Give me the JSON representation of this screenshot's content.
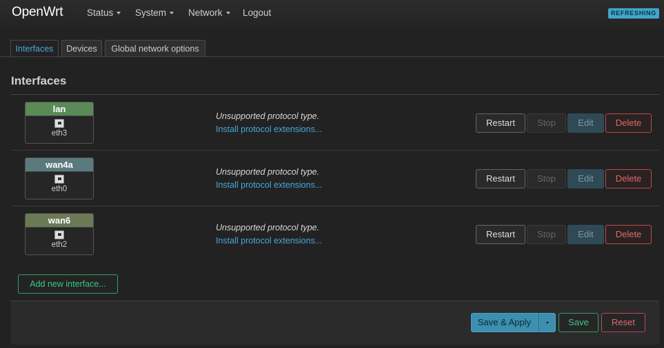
{
  "header": {
    "brand": "OpenWrt",
    "nav": [
      {
        "label": "Status",
        "dropdown": true
      },
      {
        "label": "System",
        "dropdown": true
      },
      {
        "label": "Network",
        "dropdown": true
      },
      {
        "label": "Logout",
        "dropdown": false
      }
    ],
    "badge": "REFRESHING"
  },
  "tabs": [
    {
      "label": "Interfaces",
      "active": true
    },
    {
      "label": "Devices",
      "active": false
    },
    {
      "label": "Global network options",
      "active": false
    }
  ],
  "section": {
    "title": "Interfaces"
  },
  "interfaces": [
    {
      "name": "lan",
      "device": "eth3",
      "color": "#5a8a55",
      "icon": "ethernet-port-icon",
      "status": "Unsupported protocol type.",
      "link": "Install protocol extensions..."
    },
    {
      "name": "wan4a",
      "device": "eth0",
      "color": "#5b7a7e",
      "icon": "ethernet-port-icon",
      "status": "Unsupported protocol type.",
      "link": "Install protocol extensions..."
    },
    {
      "name": "wan6",
      "device": "eth2",
      "color": "#6b7a55",
      "icon": "ethernet-port-icon",
      "status": "Unsupported protocol type.",
      "link": "Install protocol extensions..."
    }
  ],
  "row_actions": {
    "restart": "Restart",
    "stop": "Stop",
    "edit": "Edit",
    "delete": "Delete"
  },
  "add_interface": "Add new interface...",
  "footer": {
    "save_apply": "Save & Apply",
    "save": "Save",
    "reset": "Reset"
  },
  "colors": {
    "accent": "#49a6d8",
    "positive": "#3cc48a",
    "negative": "#e06a6c",
    "background": "#222222"
  }
}
